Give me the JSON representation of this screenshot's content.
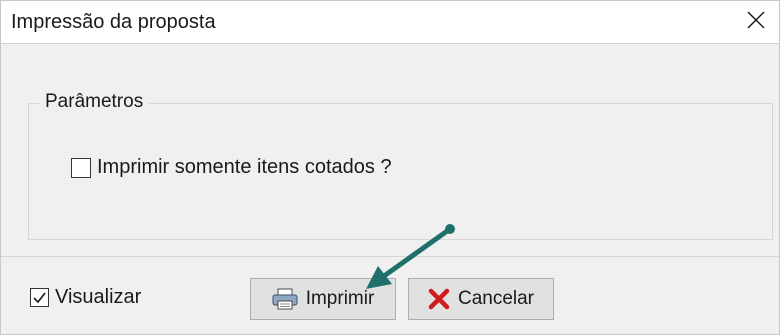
{
  "window": {
    "title": "Impressão da proposta",
    "close_icon": "close-icon"
  },
  "parameters": {
    "legend": "Parâmetros",
    "print_quoted_only": {
      "label": "Imprimir somente itens cotados ?",
      "checked": false
    }
  },
  "footer": {
    "preview": {
      "label": "Visualizar",
      "checked": true
    },
    "print_button": {
      "label": "Imprimir",
      "icon": "printer-icon"
    },
    "cancel_button": {
      "label": "Cancelar",
      "icon": "red-x-icon"
    }
  },
  "colors": {
    "accent_arrow": "#1f6f6a",
    "cancel_red": "#d11a1a"
  }
}
